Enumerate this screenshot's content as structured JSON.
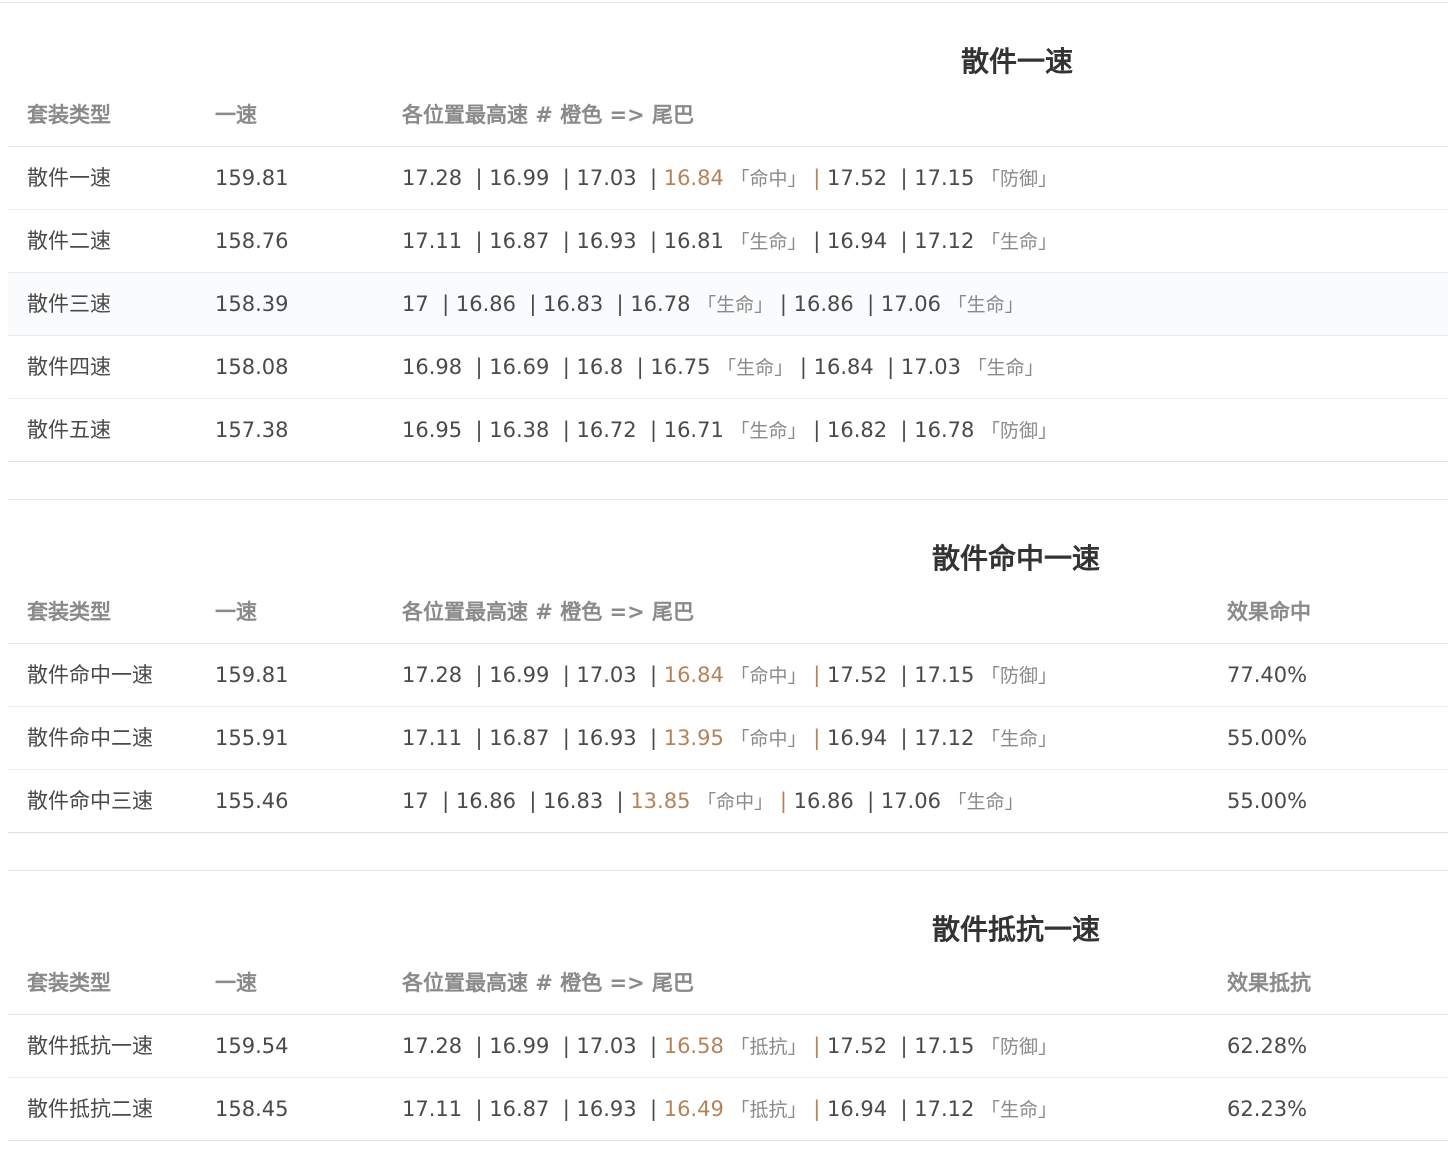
{
  "headers": {
    "type": "套装类型",
    "speed": "一速",
    "positions": "各位置最高速 # 橙色 => 尾巴",
    "hit": "效果命中",
    "resist": "效果抵抗"
  },
  "sections": [
    {
      "title": "散件一速",
      "rows": [
        {
          "name": "散件一速",
          "speed": "159.81",
          "vals": [
            "17.28",
            "16.99",
            "17.03",
            "16.84",
            "17.52",
            "17.15"
          ],
          "tag4": "「命中」",
          "tag6": "「防御」",
          "orange": true
        },
        {
          "name": "散件二速",
          "speed": "158.76",
          "vals": [
            "17.11",
            "16.87",
            "16.93",
            "16.81",
            "16.94",
            "17.12"
          ],
          "tag4": "「生命」",
          "tag6": "「生命」",
          "orange": false
        },
        {
          "name": "散件三速",
          "speed": "158.39",
          "vals": [
            "17",
            "16.86",
            "16.83",
            "16.78",
            "16.86",
            "17.06"
          ],
          "tag4": "「生命」",
          "tag6": "「生命」",
          "orange": false
        },
        {
          "name": "散件四速",
          "speed": "158.08",
          "vals": [
            "16.98",
            "16.69",
            "16.8",
            "16.75",
            "16.84",
            "17.03"
          ],
          "tag4": "「生命」",
          "tag6": "「生命」",
          "orange": false
        },
        {
          "name": "散件五速",
          "speed": "157.38",
          "vals": [
            "16.95",
            "16.38",
            "16.72",
            "16.71",
            "16.82",
            "16.78"
          ],
          "tag4": "「生命」",
          "tag6": "「防御」",
          "orange": false
        }
      ]
    },
    {
      "title": "散件命中一速",
      "rows": [
        {
          "name": "散件命中一速",
          "speed": "159.81",
          "vals": [
            "17.28",
            "16.99",
            "17.03",
            "16.84",
            "17.52",
            "17.15"
          ],
          "tag4": "「命中」",
          "tag6": "「防御」",
          "orange": true,
          "extra": "77.40%"
        },
        {
          "name": "散件命中二速",
          "speed": "155.91",
          "vals": [
            "17.11",
            "16.87",
            "16.93",
            "13.95",
            "16.94",
            "17.12"
          ],
          "tag4": "「命中」",
          "tag6": "「生命」",
          "orange": true,
          "extra": "55.00%"
        },
        {
          "name": "散件命中三速",
          "speed": "155.46",
          "vals": [
            "17",
            "16.86",
            "16.83",
            "13.85",
            "16.86",
            "17.06"
          ],
          "tag4": "「命中」",
          "tag6": "「生命」",
          "orange": true,
          "extra": "55.00%"
        }
      ]
    },
    {
      "title": "散件抵抗一速",
      "rows": [
        {
          "name": "散件抵抗一速",
          "speed": "159.54",
          "vals": [
            "17.28",
            "16.99",
            "17.03",
            "16.58",
            "17.52",
            "17.15"
          ],
          "tag4": "「抵抗」",
          "tag6": "「防御」",
          "orange": true,
          "extra": "62.28%"
        },
        {
          "name": "散件抵抗二速",
          "speed": "158.45",
          "vals": [
            "17.11",
            "16.87",
            "16.93",
            "16.49",
            "16.94",
            "17.12"
          ],
          "tag4": "「抵抗」",
          "tag6": "「生命」",
          "orange": true,
          "extra": "62.23%"
        }
      ]
    }
  ]
}
